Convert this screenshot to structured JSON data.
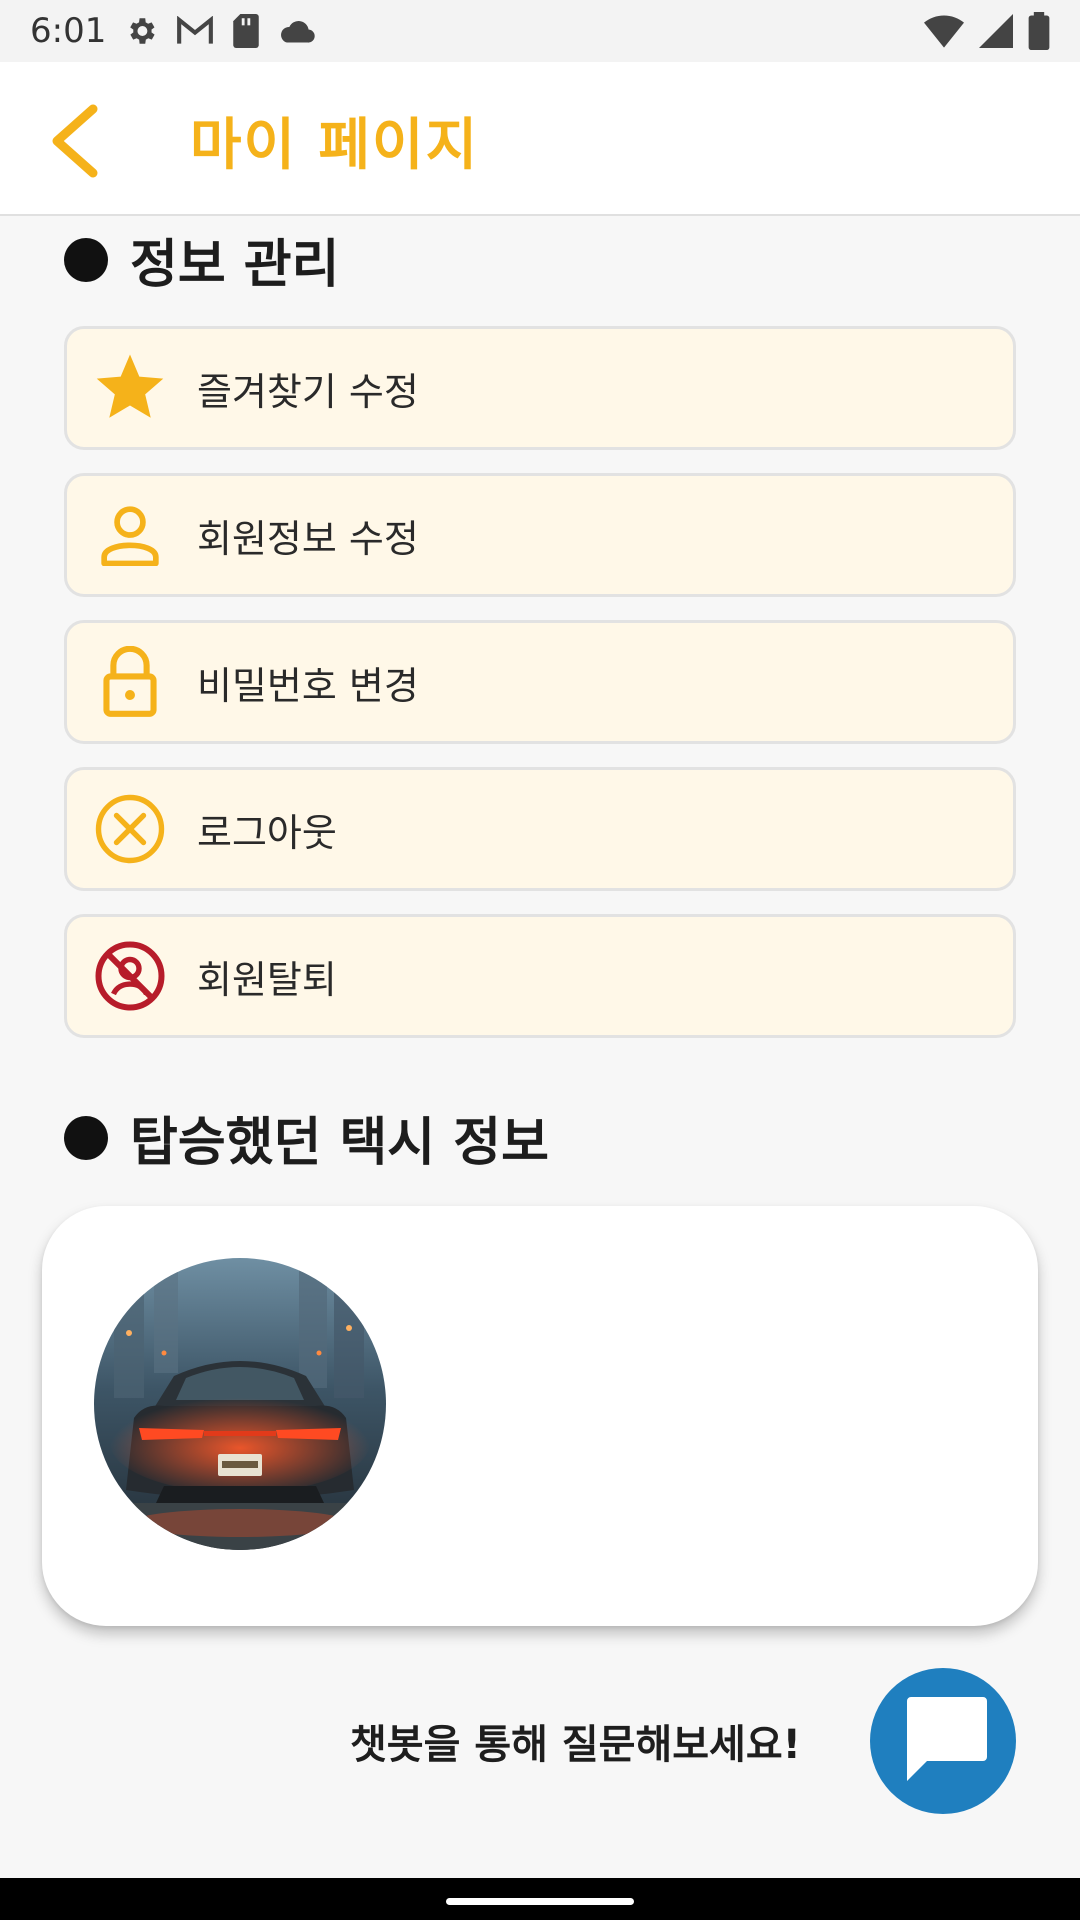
{
  "status_bar": {
    "time": "6:01",
    "left_icons": [
      "settings-icon",
      "gmail-icon",
      "sd-card-icon",
      "cloud-icon"
    ],
    "right_icons": [
      "wifi-icon",
      "signal-icon",
      "battery-icon"
    ]
  },
  "app_bar": {
    "title": "마이 페이지",
    "back_icon": "chevron-left-icon",
    "accent_color": "#f5b21a"
  },
  "info_section": {
    "title": "정보 관리",
    "items": [
      {
        "label": "즐겨찾기 수정",
        "icon": "star-icon"
      },
      {
        "label": "회원정보 수정",
        "icon": "person-icon"
      },
      {
        "label": "비밀번호 변경",
        "icon": "lock-icon"
      },
      {
        "label": "로그아웃",
        "icon": "cancel-circle-icon"
      },
      {
        "label": "회원탈퇴",
        "icon": "no-person-icon"
      }
    ],
    "item_bg_color": "#fff8e8"
  },
  "taxi_section": {
    "title": "탑승했던 택시 정보",
    "photo": "car-rear-photo"
  },
  "chatbot": {
    "hint": "챗봇을 통해 질문해보세요!",
    "button_icon": "chat-icon",
    "button_color": "#1f7fbf"
  }
}
